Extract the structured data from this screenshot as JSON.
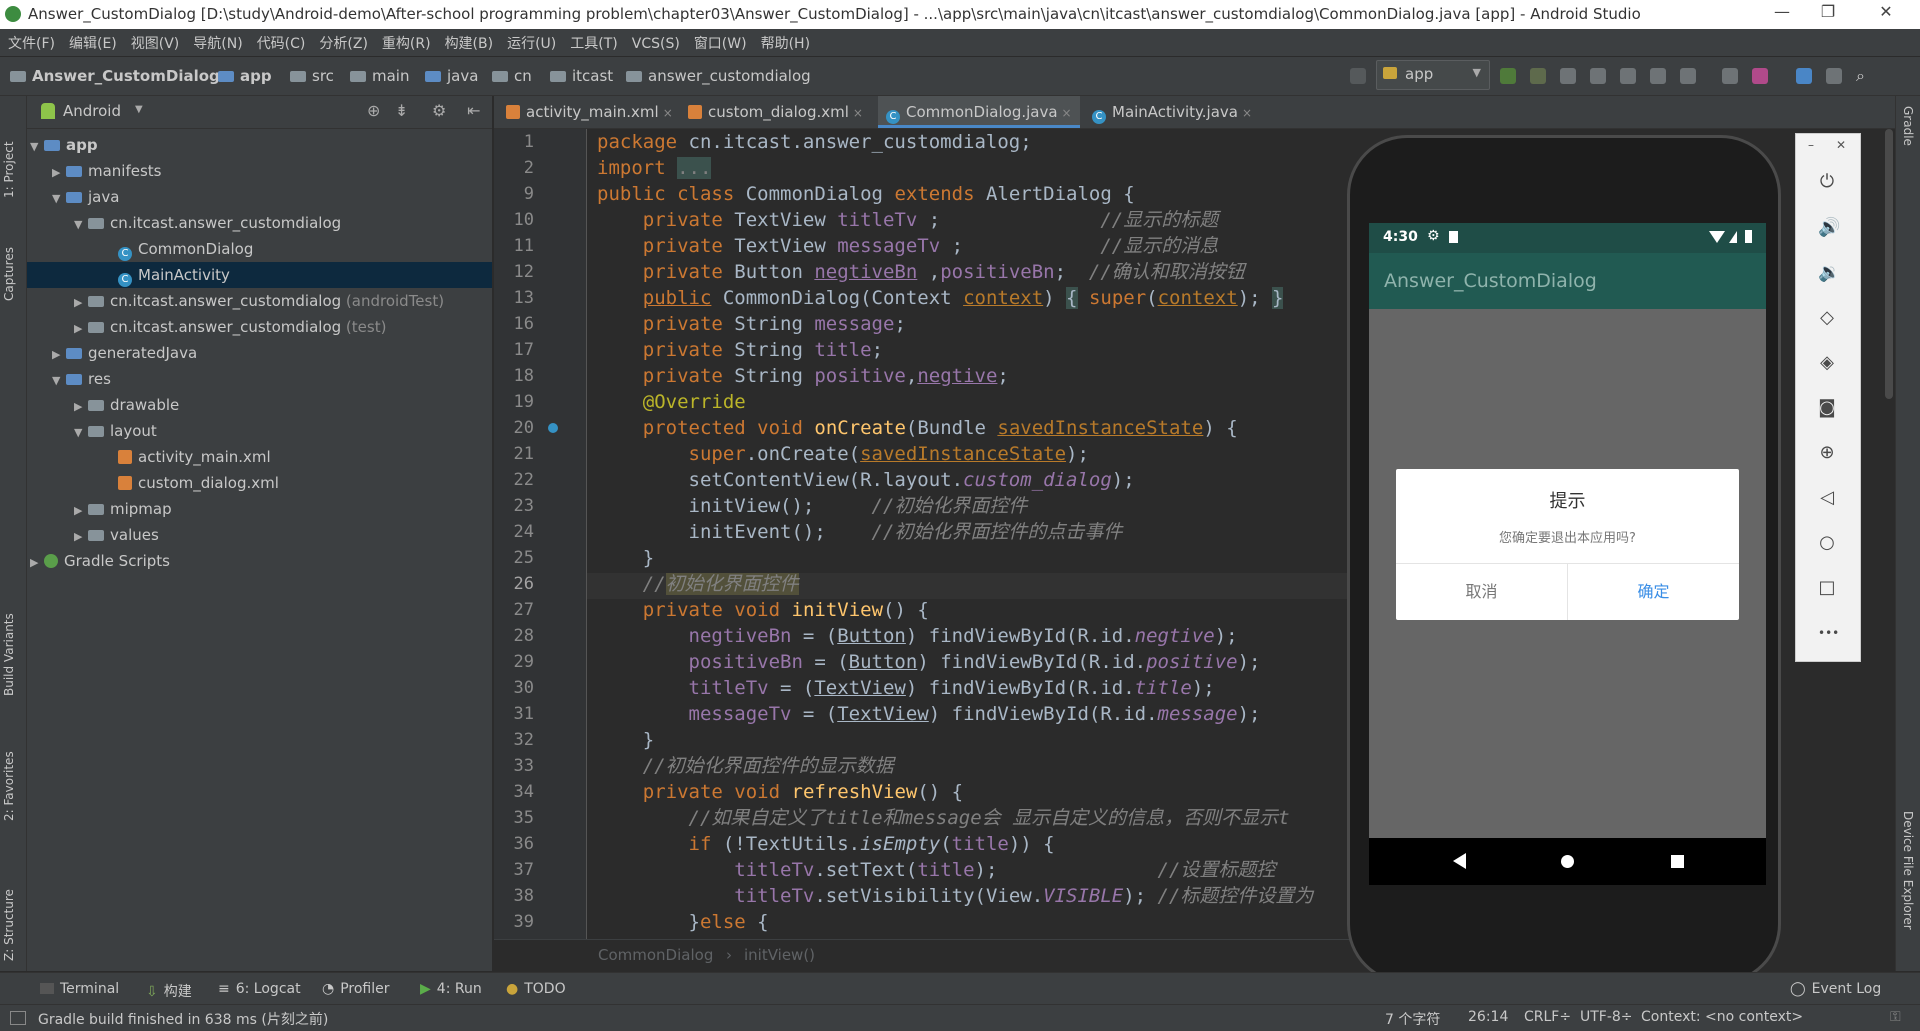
{
  "window": {
    "title": "Answer_CustomDialog [D:\\study\\Android-demo\\After-school programming problem\\chapter03\\Answer_CustomDialog] - ...\\app\\src\\main\\java\\cn\\itcast\\answer_customdialog\\CommonDialog.java [app] - Android Studio",
    "min": "—",
    "max": "❐",
    "close": "✕"
  },
  "menu": [
    "文件(F)",
    "编辑(E)",
    "视图(V)",
    "导航(N)",
    "代码(C)",
    "分析(Z)",
    "重构(R)",
    "构建(B)",
    "运行(U)",
    "工具(T)",
    "VCS(S)",
    "窗口(W)",
    "帮助(H)"
  ],
  "breadcrumb": [
    "Answer_CustomDialog",
    "app",
    "src",
    "main",
    "java",
    "cn",
    "itcast",
    "answer_customdialog"
  ],
  "run_config": "app",
  "left_stripe": [
    "1: Project",
    "Captures",
    "Build Variants",
    "2: Favorites",
    "Z: Structure"
  ],
  "right_stripe": [
    "Gradle",
    "Device File Explorer"
  ],
  "project": {
    "view": "Android",
    "tree": [
      {
        "label": "app",
        "extra": ""
      },
      {
        "label": "manifests",
        "extra": ""
      },
      {
        "label": "java",
        "extra": ""
      },
      {
        "label": "cn.itcast.answer_customdialog",
        "extra": ""
      },
      {
        "label": "CommonDialog",
        "extra": ""
      },
      {
        "label": "MainActivity",
        "extra": ""
      },
      {
        "label": "cn.itcast.answer_customdialog",
        "extra": "(androidTest)"
      },
      {
        "label": "cn.itcast.answer_customdialog",
        "extra": "(test)"
      },
      {
        "label": "generatedJava",
        "extra": ""
      },
      {
        "label": "res",
        "extra": ""
      },
      {
        "label": "drawable",
        "extra": ""
      },
      {
        "label": "layout",
        "extra": ""
      },
      {
        "label": "activity_main.xml",
        "extra": ""
      },
      {
        "label": "custom_dialog.xml",
        "extra": ""
      },
      {
        "label": "mipmap",
        "extra": ""
      },
      {
        "label": "values",
        "extra": ""
      },
      {
        "label": "Gradle Scripts",
        "extra": ""
      }
    ]
  },
  "tabs": [
    "activity_main.xml",
    "custom_dialog.xml",
    "CommonDialog.java",
    "MainActivity.java"
  ],
  "tab_close": "×",
  "line_numbers": [
    "1",
    "2",
    "9",
    "10",
    "11",
    "12",
    "13",
    "16",
    "17",
    "18",
    "19",
    "20",
    "21",
    "22",
    "23",
    "24",
    "25",
    "26",
    "27",
    "28",
    "29",
    "30",
    "31",
    "32",
    "33",
    "34",
    "35",
    "36",
    "37",
    "38",
    "39"
  ],
  "editor_crumb": [
    "CommonDialog",
    "initView()"
  ],
  "emulator": {
    "time": "4:30",
    "app_title": "Answer_CustomDialog",
    "dialog": {
      "title": "提示",
      "message": "您确定要退出本应用吗?",
      "negative": "取消",
      "positive": "确定"
    },
    "toolbar_min": "–",
    "toolbar_close": "✕",
    "more": "•••"
  },
  "bottom_tools": [
    "Terminal",
    "构建",
    "6: Logcat",
    "Profiler",
    "4: Run",
    "TODO",
    "Event Log"
  ],
  "status": {
    "message": "Gradle build finished in 638 ms (片刻之前)",
    "chars": "7 个字符",
    "position": "26:14",
    "line_sep": "CRLF÷",
    "encoding": "UTF-8÷",
    "context": "Context: <no context>"
  },
  "colors": {
    "keyword": "#cc7832",
    "comment": "#808080",
    "method": "#ffc66d",
    "field": "#9876aa",
    "annotation": "#bbb529",
    "accent": "#4a88c7",
    "app_bar": "#215a52"
  }
}
